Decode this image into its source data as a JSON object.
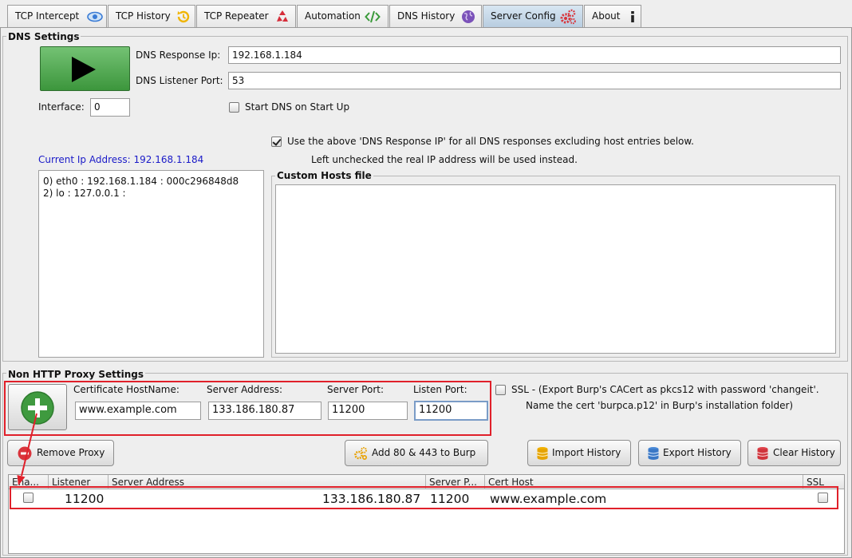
{
  "tabs": [
    {
      "label": "TCP Intercept",
      "icon": "eye-icon"
    },
    {
      "label": "TCP History",
      "icon": "history-icon"
    },
    {
      "label": "TCP Repeater",
      "icon": "recycle-icon"
    },
    {
      "label": "Automation",
      "icon": "code-icon"
    },
    {
      "label": "DNS History",
      "icon": "globe-icon"
    },
    {
      "label": "Server Config",
      "icon": "gears-icon",
      "active": true
    },
    {
      "label": "About",
      "icon": "info-icon"
    }
  ],
  "dns": {
    "title": "DNS Settings",
    "response_ip_label": "DNS Response Ip:",
    "response_ip_value": "192.168.1.184",
    "listener_port_label": "DNS Listener Port:",
    "listener_port_value": "53",
    "interface_label": "Interface:",
    "interface_value": "0",
    "start_on_startup_label": "Start DNS on Start Up",
    "start_on_startup_checked": false,
    "use_response_ip_label": "Use the above 'DNS Response IP' for all DNS responses excluding host entries below.",
    "use_response_ip_checked": true,
    "unchecked_note": "Left unchecked the real IP address will be used instead.",
    "current_ip_label": "Current Ip Address: 192.168.1.184",
    "interfaces": [
      "0) eth0 : 192.168.1.184 : 000c296848d8",
      "2) lo : 127.0.0.1 :"
    ],
    "custom_hosts_title": "Custom Hosts file",
    "custom_hosts_value": ""
  },
  "proxy": {
    "title": "Non HTTP Proxy Settings",
    "cert_hostname_label": "Certificate  HostName:",
    "cert_hostname_value": "www.example.com",
    "server_address_label": "Server Address:",
    "server_address_value": "133.186.180.87",
    "server_port_label": "Server Port:",
    "server_port_value": "11200",
    "listen_port_label": "Listen Port:",
    "listen_port_value": "11200",
    "ssl_label": "SSL - (Export Burp's CACert as pkcs12 with  password 'changeit'.",
    "ssl_note": "Name the cert 'burpca.p12'  in Burp's installation folder)",
    "ssl_checked": false
  },
  "buttons": {
    "remove_proxy": "Remove Proxy",
    "add_burp": "Add 80 & 443 to Burp",
    "import_history": "Import History",
    "export_history": "Export History",
    "clear_history": "Clear History"
  },
  "table": {
    "columns": [
      "Ena...",
      "Listener",
      "Server Address",
      "Server P...",
      "Cert Host",
      "SSL"
    ],
    "rows": [
      {
        "enabled": false,
        "listener": "11200",
        "server_address": "133.186.180.87",
        "server_port": "11200",
        "cert_host": "www.example.com",
        "ssl": false
      }
    ]
  },
  "colors": {
    "accent_blue": "#1a1ac8",
    "annotation_red": "#e0202a",
    "play_green": "#4aa64a"
  }
}
